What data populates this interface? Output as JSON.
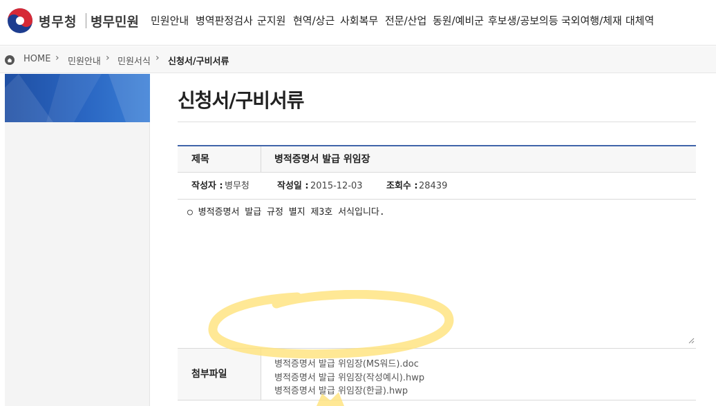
{
  "header": {
    "brand": "병무청",
    "sub_brand": "병무민원",
    "nav": [
      "민원안내",
      "병역판정검사",
      "군지원",
      "현역/상근",
      "사회복무",
      "전문/산업",
      "동원/예비군",
      "후보생/공보의등",
      "국외여행/체재",
      "대체역"
    ]
  },
  "breadcrumb": {
    "items": [
      "HOME",
      "민원안내",
      "민원서식",
      "신청서/구비서류"
    ]
  },
  "page": {
    "title": "신청서/구비서류"
  },
  "post": {
    "title_label": "제목",
    "title_value": "병적증명서 발급 위임장",
    "author_label": "작성자 :",
    "author_value": "병무청",
    "date_label": "작성일 :",
    "date_value": "2015-12-03",
    "views_label": "조회수 :",
    "views_value": "28439",
    "content": "○ 병적증명서 발급 규정 별지 제3호 서식입니다.",
    "attach_label": "첨부파일",
    "files": [
      "병적증명서 발급 위임장(MS워드).doc",
      "병적증명서 발급 위임장(작성예시).hwp",
      "병적증명서 발급 위임장(한글).hwp"
    ]
  },
  "colors": {
    "accent": "#3f64a9",
    "highlight": "#ffe27a"
  },
  "icons": {
    "logo": "taegeuk-logo-icon",
    "home": "home-icon",
    "separator": "chevron-right-icon",
    "resize": "resize-grip-icon"
  }
}
